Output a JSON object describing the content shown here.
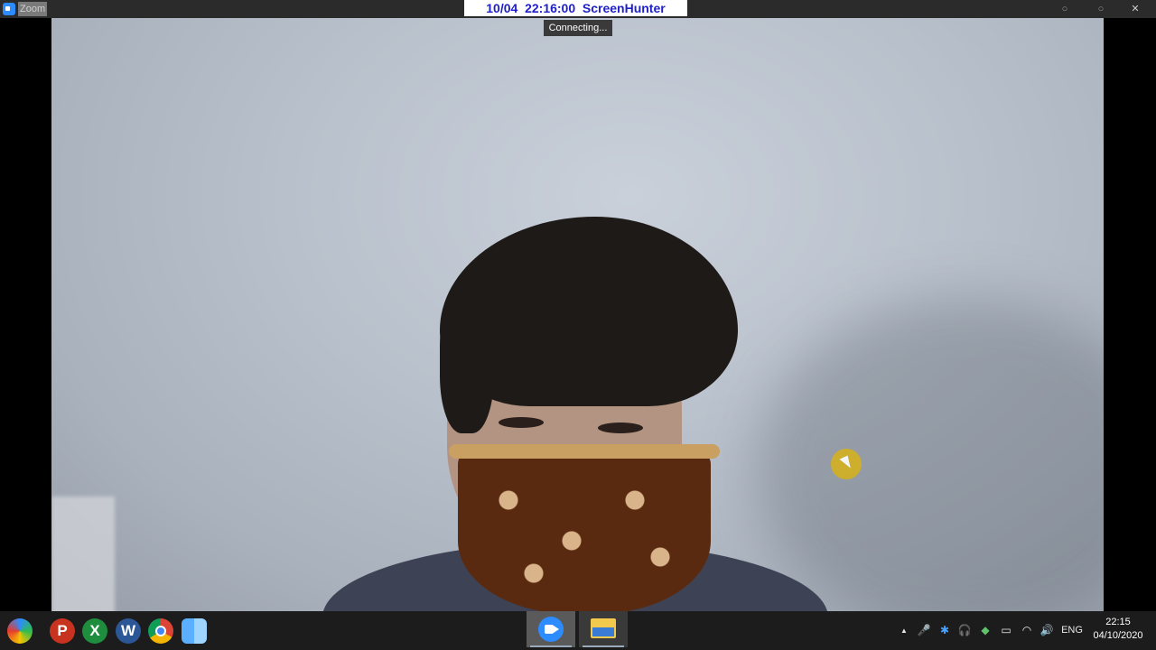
{
  "window": {
    "title": "Zoom"
  },
  "overlay": {
    "stamp": "10/04  22:16:00  ScreenHunter",
    "status": "Connecting..."
  },
  "taskbar": {
    "pinned": [
      {
        "name": "start-icon",
        "glyph": ""
      },
      {
        "name": "powerpoint-icon",
        "glyph": "P"
      },
      {
        "name": "excel-icon",
        "glyph": "X"
      },
      {
        "name": "word-icon",
        "glyph": "W"
      },
      {
        "name": "chrome-icon",
        "glyph": ""
      },
      {
        "name": "finder-icon",
        "glyph": ""
      }
    ],
    "tray": {
      "overflow": "▲",
      "mic": "🎤",
      "bluetooth": "✱",
      "headset": "🎧",
      "network_app": "◆",
      "battery": "▭",
      "wifi": "◠",
      "volume": "🔊",
      "language": "ENG",
      "time": "22:15",
      "date": "04/10/2020"
    }
  },
  "colors": {
    "zoom_blue": "#2d8cff",
    "stamp_text": "#2020c8",
    "cursor_highlight": "#d4b020"
  }
}
